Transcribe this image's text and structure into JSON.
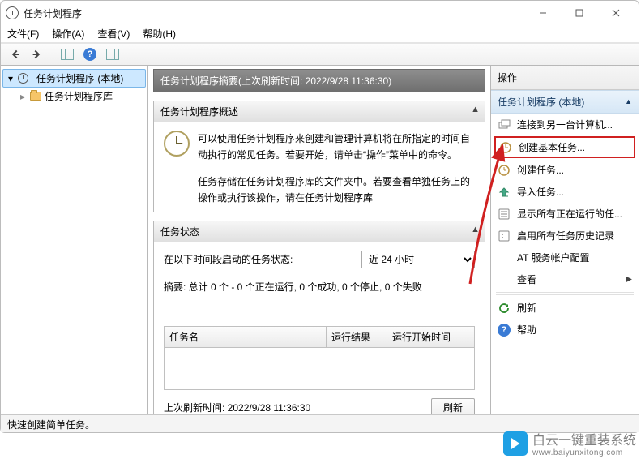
{
  "window": {
    "title": "任务计划程序"
  },
  "menu": {
    "file": "文件(F)",
    "action": "操作(A)",
    "view": "查看(V)",
    "help": "帮助(H)"
  },
  "tree": {
    "root": "任务计划程序 (本地)",
    "library": "任务计划程序库"
  },
  "main": {
    "header": "任务计划程序摘要(上次刷新时间: 2022/9/28 11:36:30)",
    "overview_title": "任务计划程序概述",
    "overview_p1": "可以使用任务计划程序来创建和管理计算机将在所指定的时间自动执行的常见任务。若要开始，请单击“操作”菜单中的命令。",
    "overview_p2": "任务存储在任务计划程序库的文件夹中。若要查看单独任务上的操作或执行该操作，请在任务计划程序库",
    "status_title": "任务状态",
    "status_prompt": "在以下时间段启动的任务状态:",
    "status_select": "近 24 小时",
    "summary": "摘要: 总计 0 个 - 0 个正在运行, 0 个成功, 0 个停止, 0 个失败",
    "col_name": "任务名",
    "col_result": "运行结果",
    "col_start": "运行开始时间",
    "last_refresh": "上次刷新时间: 2022/9/28 11:36:30",
    "refresh_btn": "刷新"
  },
  "actions": {
    "title": "操作",
    "group": "任务计划程序 (本地)",
    "items": [
      {
        "label": "连接到另一台计算机..."
      },
      {
        "label": "创建基本任务...",
        "highlight": true
      },
      {
        "label": "创建任务..."
      },
      {
        "label": "导入任务..."
      },
      {
        "label": "显示所有正在运行的任..."
      },
      {
        "label": "启用所有任务历史记录"
      },
      {
        "label": "AT 服务帐户配置"
      },
      {
        "label": "查看",
        "submenu": true
      },
      {
        "label": "刷新",
        "divider_before": true
      },
      {
        "label": "帮助"
      }
    ]
  },
  "statusbar": "快速创建简单任务。",
  "watermark": {
    "brand": "白云一键重装系统",
    "url": "www.baiyunxitong.com"
  }
}
